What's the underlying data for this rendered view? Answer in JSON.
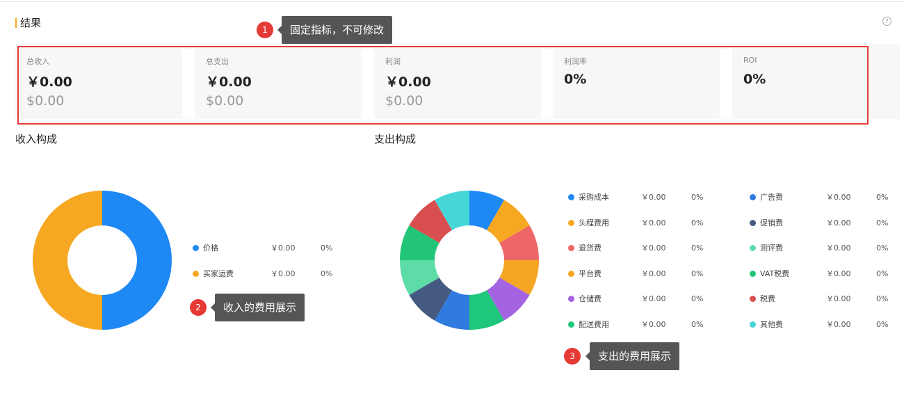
{
  "section": {
    "title": "结果"
  },
  "metrics": [
    {
      "label": "总收入",
      "rmb": "￥0.00",
      "usd": "$0.00"
    },
    {
      "label": "总支出",
      "rmb": "￥0.00",
      "usd": "$0.00"
    },
    {
      "label": "利润",
      "rmb": "￥0.00",
      "usd": "$0.00"
    },
    {
      "label": "利润率",
      "rmb": "0%",
      "usd": ""
    },
    {
      "label": "ROI",
      "rmb": "0%",
      "usd": ""
    }
  ],
  "income": {
    "title": "收入构成",
    "items": [
      {
        "name": "价格",
        "amount": "￥0.00",
        "pct": "0%",
        "color": "#1e88f5"
      },
      {
        "name": "买家运费",
        "amount": "￥0.00",
        "pct": "0%",
        "color": "#f7a823"
      }
    ]
  },
  "expense": {
    "title": "支出构成",
    "items": [
      {
        "name": "采购成本",
        "amount": "￥0.00",
        "pct": "0%",
        "color": "#1e88f5"
      },
      {
        "name": "头程费用",
        "amount": "￥0.00",
        "pct": "0%",
        "color": "#f7a823"
      },
      {
        "name": "退货费",
        "amount": "￥0.00",
        "pct": "0%",
        "color": "#ee6666"
      },
      {
        "name": "平台费",
        "amount": "￥0.00",
        "pct": "0%",
        "color": "#f5a623"
      },
      {
        "name": "仓储费",
        "amount": "￥0.00",
        "pct": "0%",
        "color": "#a463e0"
      },
      {
        "name": "配送费用",
        "amount": "￥0.00",
        "pct": "0%",
        "color": "#1ec77a"
      },
      {
        "name": "广告费",
        "amount": "￥0.00",
        "pct": "0%",
        "color": "#2f7be0"
      },
      {
        "name": "促销费",
        "amount": "￥0.00",
        "pct": "0%",
        "color": "#455a80"
      },
      {
        "name": "测评费",
        "amount": "￥0.00",
        "pct": "0%",
        "color": "#5ddca8"
      },
      {
        "name": "VAT税费",
        "amount": "￥0.00",
        "pct": "0%",
        "color": "#22c577"
      },
      {
        "name": "税费",
        "amount": "￥0.00",
        "pct": "0%",
        "color": "#d94e4e"
      },
      {
        "name": "其他费",
        "amount": "￥0.00",
        "pct": "0%",
        "color": "#46d6d8"
      }
    ]
  },
  "callouts": [
    {
      "num": "1",
      "text": "固定指标，不可修改"
    },
    {
      "num": "2",
      "text": "收入的费用展示"
    },
    {
      "num": "3",
      "text": "支出的费用展示"
    }
  ],
  "chart_data": [
    {
      "type": "pie",
      "title": "收入构成",
      "labels": [
        "价格",
        "买家运费"
      ],
      "values": [
        0,
        0
      ],
      "colors": [
        "#1e88f5",
        "#f7a823"
      ]
    },
    {
      "type": "pie",
      "title": "支出构成",
      "labels": [
        "采购成本",
        "头程费用",
        "退货费",
        "平台费",
        "仓储费",
        "配送费用",
        "广告费",
        "促销费",
        "测评费",
        "VAT税费",
        "税费",
        "其他费"
      ],
      "values": [
        0,
        0,
        0,
        0,
        0,
        0,
        0,
        0,
        0,
        0,
        0,
        0
      ],
      "colors": [
        "#1e88f5",
        "#f7a823",
        "#ee6666",
        "#f5a623",
        "#a463e0",
        "#1ec77a",
        "#2f7be0",
        "#455a80",
        "#5ddca8",
        "#22c577",
        "#d94e4e",
        "#46d6d8"
      ]
    }
  ]
}
